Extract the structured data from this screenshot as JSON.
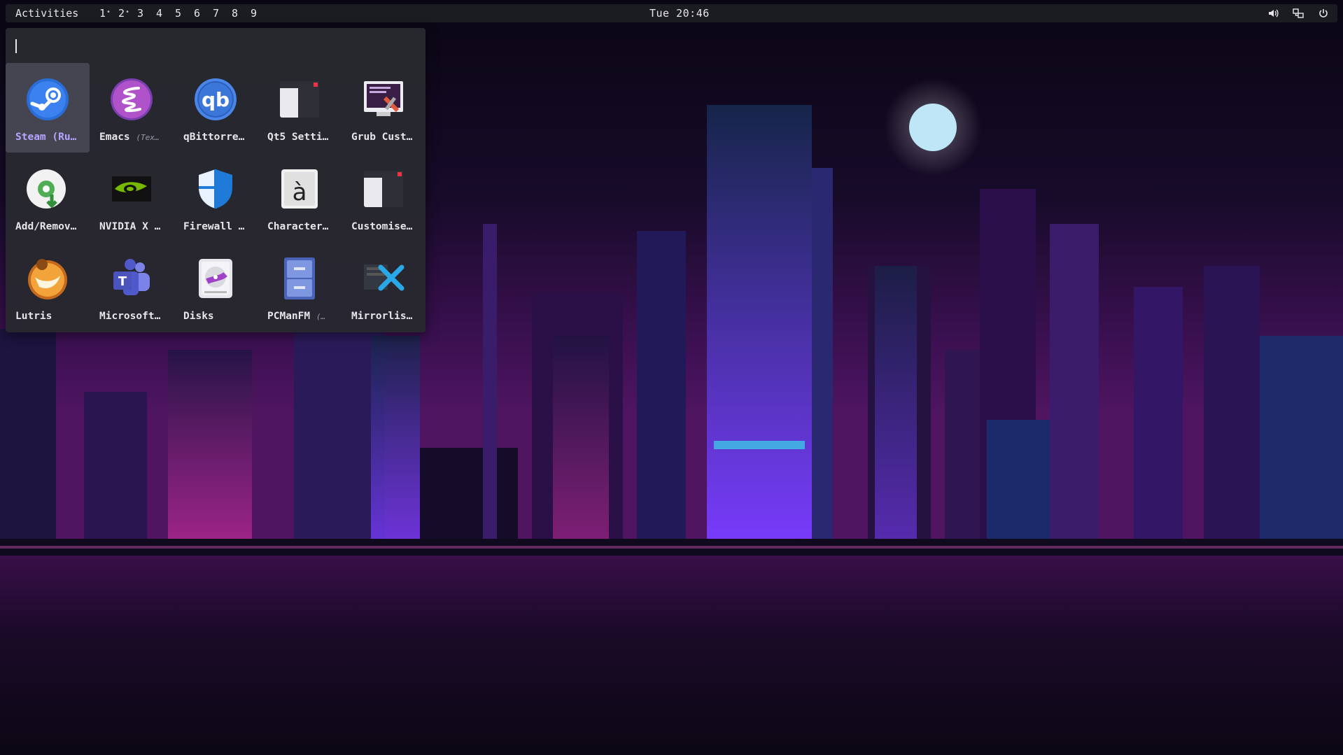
{
  "topbar": {
    "activities": "Activities",
    "workspaces": [
      {
        "label": "1",
        "occupied": true
      },
      {
        "label": "2",
        "occupied": true
      },
      {
        "label": "3",
        "occupied": false
      },
      {
        "label": "4",
        "occupied": false
      },
      {
        "label": "5",
        "occupied": false
      },
      {
        "label": "6",
        "occupied": false
      },
      {
        "label": "7",
        "occupied": false
      },
      {
        "label": "8",
        "occupied": false
      },
      {
        "label": "9",
        "occupied": false
      }
    ],
    "clock": "Tue 20:46",
    "tray": [
      "volume-icon",
      "network-icon",
      "power-icon"
    ]
  },
  "launcher": {
    "search_value": "",
    "apps": [
      {
        "name": "steam",
        "label": "Steam (Ru…",
        "sub": "",
        "icon": "steam-icon",
        "selected": true
      },
      {
        "name": "emacs",
        "label": "Emacs ",
        "sub": "(Tex…",
        "icon": "emacs-icon",
        "selected": false
      },
      {
        "name": "qbittorrent",
        "label": "qBittorre…",
        "sub": "",
        "icon": "qbittorrent-icon",
        "selected": false
      },
      {
        "name": "qt5-settings",
        "label": "Qt5 Setti…",
        "sub": "",
        "icon": "qt5-settings-icon",
        "selected": false
      },
      {
        "name": "grub-customizer",
        "label": "Grub Cust…",
        "sub": "",
        "icon": "grub-customizer-icon",
        "selected": false
      },
      {
        "name": "add-remove-software",
        "label": "Add/Remov…",
        "sub": "",
        "icon": "software-install-icon",
        "selected": false
      },
      {
        "name": "nvidia-settings",
        "label": "NVIDIA X …",
        "sub": "",
        "icon": "nvidia-icon",
        "selected": false
      },
      {
        "name": "firewall",
        "label": "Firewall …",
        "sub": "",
        "icon": "firewall-shield-icon",
        "selected": false
      },
      {
        "name": "character-map",
        "label": "Character…",
        "sub": "",
        "icon": "character-map-icon",
        "selected": false
      },
      {
        "name": "customise-look",
        "label": "Customise…",
        "sub": "",
        "icon": "customise-look-icon",
        "selected": false
      },
      {
        "name": "lutris",
        "label": "Lutris",
        "sub": "",
        "icon": "lutris-icon",
        "selected": false
      },
      {
        "name": "microsoft-teams",
        "label": "Microsoft…",
        "sub": "",
        "icon": "teams-icon",
        "selected": false
      },
      {
        "name": "disks",
        "label": "Disks",
        "sub": "",
        "icon": "disks-icon",
        "selected": false
      },
      {
        "name": "pcmanfm",
        "label": "PCManFM ",
        "sub": "(…",
        "icon": "file-cabinet-icon",
        "selected": false
      },
      {
        "name": "mirrorlist",
        "label": "Mirrorlis…",
        "sub": "",
        "icon": "mirrorlist-tools-icon",
        "selected": false
      }
    ]
  },
  "colors": {
    "topbar_bg": "#1b1b22",
    "launcher_bg": "#28282f",
    "selected_bg": "#454552",
    "selected_text": "#b7a4ff",
    "moon": "#bfe6f7"
  }
}
